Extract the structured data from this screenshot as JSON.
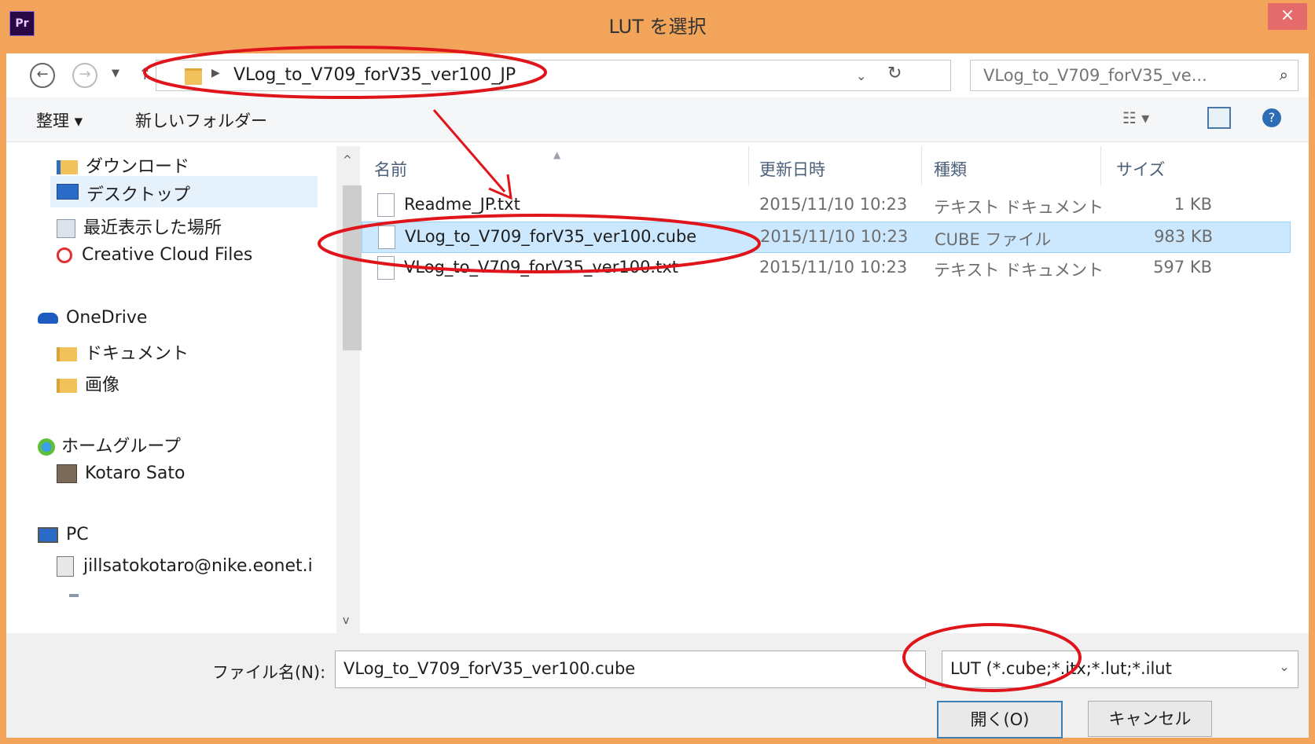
{
  "window": {
    "app_icon": "Pr",
    "title": "LUT を選択",
    "close_glyph": "×"
  },
  "address": {
    "path": "VLog_to_V709_forV35_ver100_JP",
    "search_placeholder": "VLog_to_V709_forV35_ve..."
  },
  "toolbar": {
    "organize": "整理 ▾",
    "new_folder": "新しいフォルダー"
  },
  "nav": {
    "items": [
      {
        "label": "ダウンロード",
        "icon": "download-folder-icon"
      },
      {
        "label": "デスクトップ",
        "icon": "desktop-icon"
      },
      {
        "label": "最近表示した場所",
        "icon": "recent-places-icon"
      },
      {
        "label": "Creative Cloud Files",
        "icon": "creative-cloud-icon"
      },
      {
        "label": "OneDrive",
        "icon": "cloud-icon"
      },
      {
        "label": "ドキュメント",
        "icon": "folder-icon"
      },
      {
        "label": "画像",
        "icon": "folder-icon"
      },
      {
        "label": "ホームグループ",
        "icon": "homegroup-icon"
      },
      {
        "label": "Kotaro Sato",
        "icon": "user-icon"
      },
      {
        "label": "PC",
        "icon": "computer-icon"
      },
      {
        "label": "jillsatokotaro@nike.eonet.i",
        "icon": "network-drive-icon"
      }
    ]
  },
  "list": {
    "columns": [
      "名前",
      "更新日時",
      "種類",
      "サイズ"
    ],
    "rows": [
      {
        "name": "Readme_JP.txt",
        "date": "2015/11/10 10:23",
        "type": "テキスト ドキュメント",
        "size": "1 KB"
      },
      {
        "name": "VLog_to_V709_forV35_ver100.cube",
        "date": "2015/11/10 10:23",
        "type": "CUBE ファイル",
        "size": "983 KB"
      },
      {
        "name": "VLog_to_V709_forV35_ver100.txt",
        "date": "2015/11/10 10:23",
        "type": "テキスト ドキュメント",
        "size": "597 KB"
      }
    ]
  },
  "bottom": {
    "filename_label": "ファイル名(N):",
    "filename_value": "VLog_to_V709_forV35_ver100.cube",
    "filter_value": "LUT (*.cube;*.itx;*.lut;*.ilut",
    "open_label": "開く(O)",
    "cancel_label": "キャンセル"
  },
  "colors": {
    "frame": "#f2a55a",
    "selection": "#cce8ff",
    "annotation": "#e0151b"
  }
}
